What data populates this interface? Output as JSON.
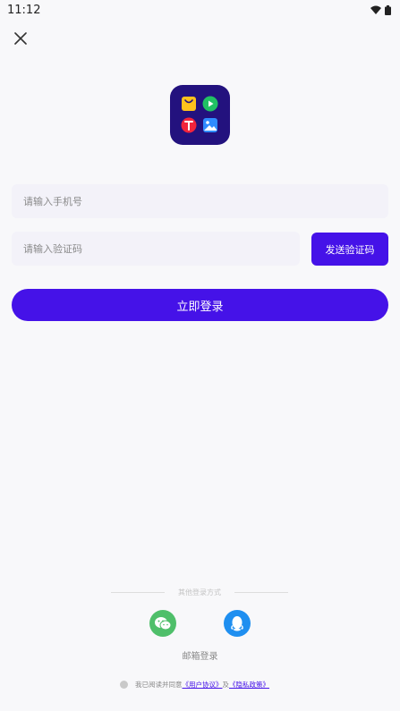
{
  "status_bar": {
    "time": "11:12"
  },
  "login": {
    "phone_placeholder": "请输入手机号",
    "code_placeholder": "请输入验证码",
    "send_code_label": "发送验证码",
    "submit_label": "立即登录"
  },
  "other_login": {
    "title": "其他登录方式",
    "email_login": "邮箱登录"
  },
  "agreement": {
    "prefix": "我已阅读并同意",
    "user_agreement": "《用户协议》",
    "and": "及",
    "privacy_policy": "《隐私政策》"
  },
  "colors": {
    "accent": "#4512e8",
    "logo_bg": "#23127e",
    "wechat": "#4fbf6a",
    "qq": "#1f8ff0"
  },
  "icons": [
    "wifi-icon",
    "battery-icon",
    "close-icon",
    "app-logo",
    "wechat-icon",
    "qq-icon"
  ]
}
